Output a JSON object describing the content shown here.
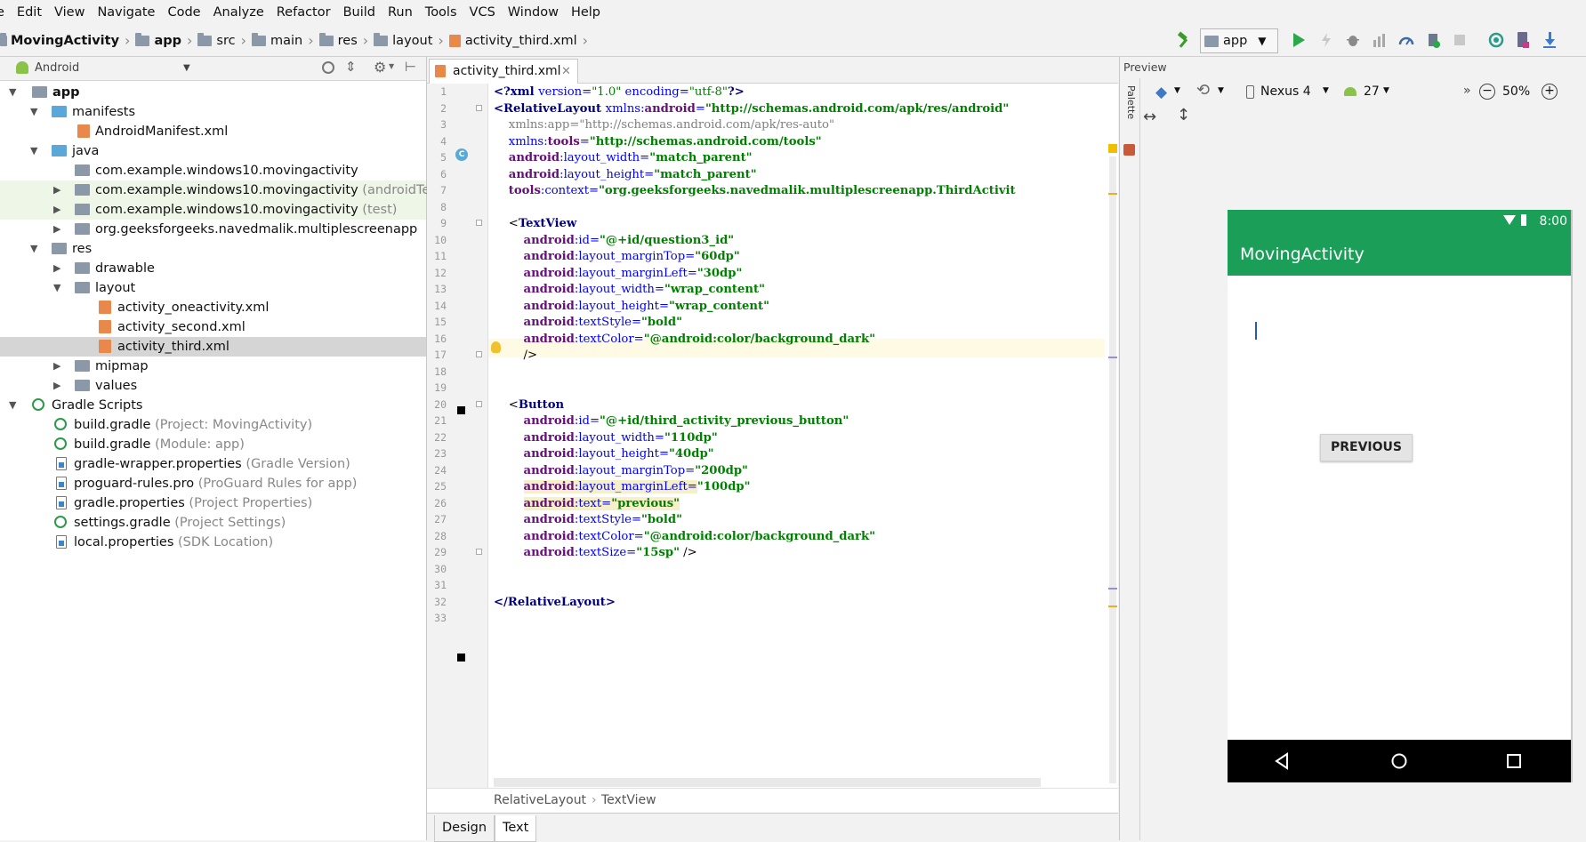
{
  "menu": [
    "e",
    "Edit",
    "View",
    "Navigate",
    "Code",
    "Analyze",
    "Refactor",
    "Build",
    "Run",
    "Tools",
    "VCS",
    "Window",
    "Help"
  ],
  "breadcrumbs": [
    "MovingActivity",
    "app",
    "src",
    "main",
    "res",
    "layout",
    "activity_third.xml"
  ],
  "run_config": "app",
  "project_view": "Android",
  "tree": [
    {
      "label": "app",
      "hint": ""
    },
    {
      "label": "manifests",
      "hint": ""
    },
    {
      "label": "AndroidManifest.xml",
      "hint": ""
    },
    {
      "label": "java",
      "hint": ""
    },
    {
      "label": "com.example.windows10.movingactivity",
      "hint": ""
    },
    {
      "label": "com.example.windows10.movingactivity",
      "hint": "(androidTest)"
    },
    {
      "label": "com.example.windows10.movingactivity",
      "hint": "(test)"
    },
    {
      "label": "org.geeksforgeeks.navedmalik.multiplescreenapp",
      "hint": ""
    },
    {
      "label": "res",
      "hint": ""
    },
    {
      "label": "drawable",
      "hint": ""
    },
    {
      "label": "layout",
      "hint": ""
    },
    {
      "label": "activity_oneactivity.xml",
      "hint": ""
    },
    {
      "label": "activity_second.xml",
      "hint": ""
    },
    {
      "label": "activity_third.xml",
      "hint": ""
    },
    {
      "label": "mipmap",
      "hint": ""
    },
    {
      "label": "values",
      "hint": ""
    },
    {
      "label": "Gradle Scripts",
      "hint": ""
    },
    {
      "label": "build.gradle",
      "hint": "(Project: MovingActivity)"
    },
    {
      "label": "build.gradle",
      "hint": "(Module: app)"
    },
    {
      "label": "gradle-wrapper.properties",
      "hint": "(Gradle Version)"
    },
    {
      "label": "proguard-rules.pro",
      "hint": "(ProGuard Rules for app)"
    },
    {
      "label": "gradle.properties",
      "hint": "(Project Properties)"
    },
    {
      "label": "settings.gradle",
      "hint": "(Project Settings)"
    },
    {
      "label": "local.properties",
      "hint": "(SDK Location)"
    }
  ],
  "editor": {
    "tab": "activity_third.xml",
    "line_numbers": [
      "1",
      "2",
      "3",
      "4",
      "5",
      "6",
      "7",
      "8",
      "9",
      "10",
      "11",
      "12",
      "13",
      "14",
      "15",
      "16",
      "17",
      "18",
      "19",
      "20",
      "21",
      "22",
      "23",
      "24",
      "25",
      "26",
      "27",
      "28",
      "29",
      "30",
      "31",
      "32",
      "33"
    ],
    "code": {
      "l1": [
        "<?xml ",
        "version=",
        "\"1.0\"",
        " encoding=",
        "\"utf-8\"",
        "?>"
      ],
      "l2": [
        "<RelativeLayout ",
        "xmlns:",
        "android",
        "=",
        "\"http://schemas.android.com/apk/res/android\""
      ],
      "l3": [
        "    xmlns:app=\"http://schemas.android.com/apk/res-auto\""
      ],
      "l4": [
        "    ",
        "xmlns:",
        "tools",
        "=",
        "\"http://schemas.android.com/tools\""
      ],
      "l5": [
        "    ",
        "android",
        ":layout_width=",
        "\"match_parent\""
      ],
      "l6": [
        "    ",
        "android",
        ":layout_height=",
        "\"match_parent\""
      ],
      "l7": [
        "    ",
        "tools",
        ":context=",
        "\"org.geeksforgeeks.navedmalik.multiplescreenapp.ThirdActivit"
      ],
      "l9": [
        "    <",
        "TextView"
      ],
      "l10": [
        "        ",
        "android",
        ":id=",
        "\"@+id/question3_id\""
      ],
      "l11": [
        "        ",
        "android",
        ":layout_marginTop=",
        "\"60dp\""
      ],
      "l12": [
        "        ",
        "android",
        ":layout_marginLeft=",
        "\"30dp\""
      ],
      "l13": [
        "        ",
        "android",
        ":layout_width=",
        "\"wrap_content\""
      ],
      "l14": [
        "        ",
        "android",
        ":layout_height=",
        "\"wrap_content\""
      ],
      "l15": [
        "        ",
        "android",
        ":textStyle=",
        "\"bold\""
      ],
      "l16": [
        "        ",
        "android",
        ":textColor=",
        "\"@android:color/background_dark\""
      ],
      "l17": [
        "        />"
      ],
      "l20": [
        "    <",
        "Button"
      ],
      "l21": [
        "        ",
        "android",
        ":id=",
        "\"@+id/third_activity_previous_button\""
      ],
      "l22": [
        "        ",
        "android",
        ":layout_width=",
        "\"110dp\""
      ],
      "l23": [
        "        ",
        "android",
        ":layout_height=",
        "\"40dp\""
      ],
      "l24": [
        "        ",
        "android",
        ":layout_marginTop=",
        "\"200dp\""
      ],
      "l25": [
        "        ",
        "android",
        ":layout_marginLeft=",
        "\"100dp\""
      ],
      "l26": [
        "        ",
        "android",
        ":text=",
        "\"previous\""
      ],
      "l27": [
        "        ",
        "android",
        ":textStyle=",
        "\"bold\""
      ],
      "l28": [
        "        ",
        "android",
        ":textColor=",
        "\"@android:color/background_dark\""
      ],
      "l29": [
        "        ",
        "android",
        ":textSize=",
        "\"15sp\"",
        " />"
      ],
      "l32": [
        "</",
        "RelativeLayout",
        ">"
      ]
    },
    "breadcrumb": [
      "RelativeLayout",
      "TextView"
    ],
    "bottom_tabs": [
      "Design",
      "Text"
    ]
  },
  "preview": {
    "title": "Preview",
    "palette": "Palette",
    "device": "Nexus 4",
    "api": "27",
    "zoom": "50%",
    "time": "8:00",
    "app_title": "MovingActivity",
    "button_label": "PREVIOUS",
    "overflow": "»"
  },
  "colors": {
    "accent_green": "#1b9e58",
    "tag": "#000080",
    "attr": "#0000ff",
    "ns": "#660e7a",
    "string": "#008000"
  }
}
